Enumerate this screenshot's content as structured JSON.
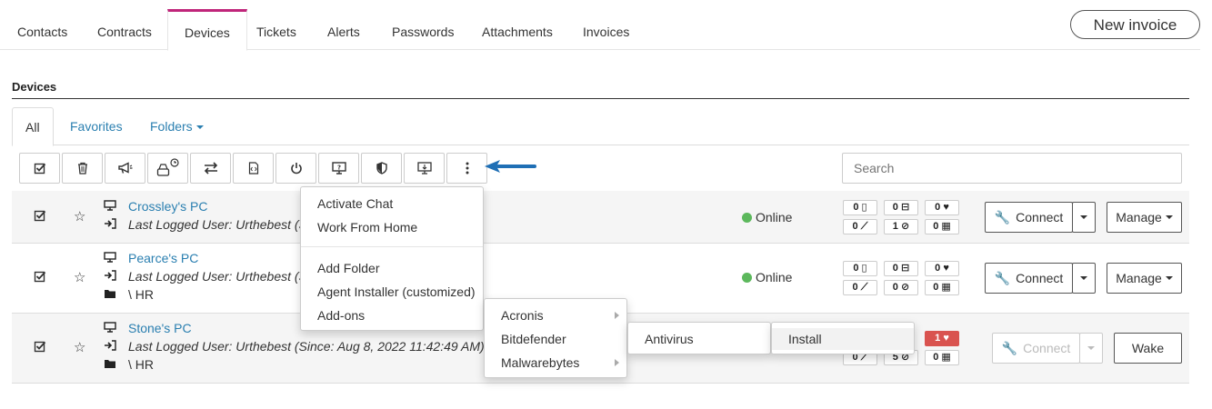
{
  "top_tabs": [
    "Contacts",
    "Contracts",
    "Devices",
    "Tickets",
    "Alerts",
    "Passwords",
    "Attachments",
    "Invoices"
  ],
  "active_top_tab": "Devices",
  "new_invoice_label": "New invoice",
  "section_title": "Devices",
  "sub_tabs": {
    "all": "All",
    "favorites": "Favorites",
    "folders": "Folders"
  },
  "search_placeholder": "Search",
  "toolbar_icons": [
    "check-all-icon",
    "trash-icon",
    "megaphone-icon",
    "drive-clock-icon",
    "transfer-icon",
    "script-icon",
    "power-icon",
    "remote-help-icon",
    "shield-icon",
    "download-monitor-icon",
    "more-vertical-icon"
  ],
  "devices": [
    {
      "name": "Crossley's PC",
      "last_user": "Last Logged User: Urthebest (Sinc",
      "folder": "",
      "status": "Online",
      "badges": [
        "0",
        "0",
        "0",
        "0",
        "1",
        "0"
      ],
      "connect_label": "Connect",
      "action_label": "Manage"
    },
    {
      "name": "Pearce's PC",
      "last_user": "Last Logged User: Urthebest (Sinc",
      "folder": "\\ HR",
      "status": "Online",
      "badges": [
        "0",
        "0",
        "0",
        "0",
        "0",
        "0"
      ],
      "connect_label": "Connect",
      "action_label": "Manage"
    },
    {
      "name": "Stone's PC",
      "last_user": "Last Logged User: Urthebest (Since: Aug 8, 2022 11:42:49 AM)",
      "folder": "\\ HR",
      "status": "",
      "badges": [
        "1",
        "0",
        "5",
        "0"
      ],
      "connect_label": "Connect",
      "action_label": "Wake"
    }
  ],
  "menu": {
    "group1": [
      "Activate Chat",
      "Work From Home"
    ],
    "group2": [
      "Add Folder",
      "Agent Installer (customized)",
      "Add-ons"
    ]
  },
  "addons_menu": [
    "Acronis",
    "Bitdefender",
    "Malwarebytes"
  ],
  "bitdefender_menu": [
    "Antivirus"
  ],
  "antivirus_menu": [
    "Install"
  ],
  "colors": {
    "accent_tab": "#c0257a",
    "link": "#2a7fb0",
    "online": "#5cb85c",
    "alert": "#d9534f",
    "arrow": "#1f6fb5"
  }
}
